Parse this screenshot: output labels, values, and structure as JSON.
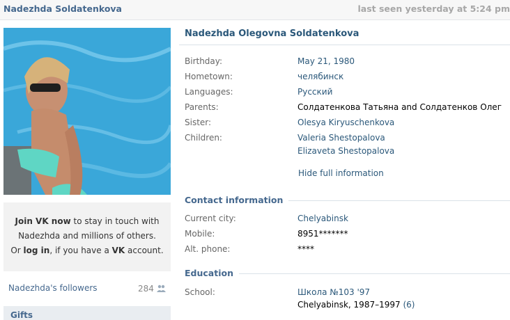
{
  "header": {
    "name": "Nadezhda Soldatenkova",
    "last_seen": "last seen yesterday at 5:24 pm"
  },
  "profile": {
    "full_name": "Nadezhda Olegovna Soldatenkova",
    "info": {
      "birthday_label": "Birthday:",
      "birthday": "May 21, 1980",
      "hometown_label": "Hometown:",
      "hometown": "челябинск",
      "languages_label": "Languages:",
      "languages": "Русский",
      "parents_label": "Parents:",
      "parents": "Солдатенкова Татьяна and Солдатенков Олег",
      "sister_label": "Sister:",
      "sister": "Olesya Kiryuschenkova",
      "children_label": "Children:",
      "children": [
        "Valeria Shestopalova",
        "Elizaveta Shestopalova"
      ],
      "hide_link": "Hide full information"
    },
    "contact": {
      "title": "Contact information",
      "city_label": "Current city:",
      "city": "Chelyabinsk",
      "mobile_label": "Mobile:",
      "mobile": "8951*******",
      "alt_label": "Alt. phone:",
      "alt": "****"
    },
    "education": {
      "title": "Education",
      "school_label": "School:",
      "school": "Школа №103 '97",
      "school_detail": "Chelyabinsk, 1987–1997",
      "school_count": "(6)"
    }
  },
  "sidebar": {
    "join_line1_bold": "Join VK now",
    "join_line1_rest": " to stay in touch with",
    "join_line2": "Nadezhda and millions of others.",
    "join_line3_a": "Or ",
    "join_line3_login": "log in",
    "join_line3_b": ", if you have a ",
    "join_line3_vk": "VK",
    "join_line3_c": " account.",
    "followers_label": "Nadezhda's followers",
    "followers_count": "284",
    "gifts_title": "Gifts"
  },
  "colors": {
    "link": "#2b587a",
    "header_link": "#45688e",
    "join_bg": "#f2f2f2",
    "pool_water": "#39a6d8"
  }
}
